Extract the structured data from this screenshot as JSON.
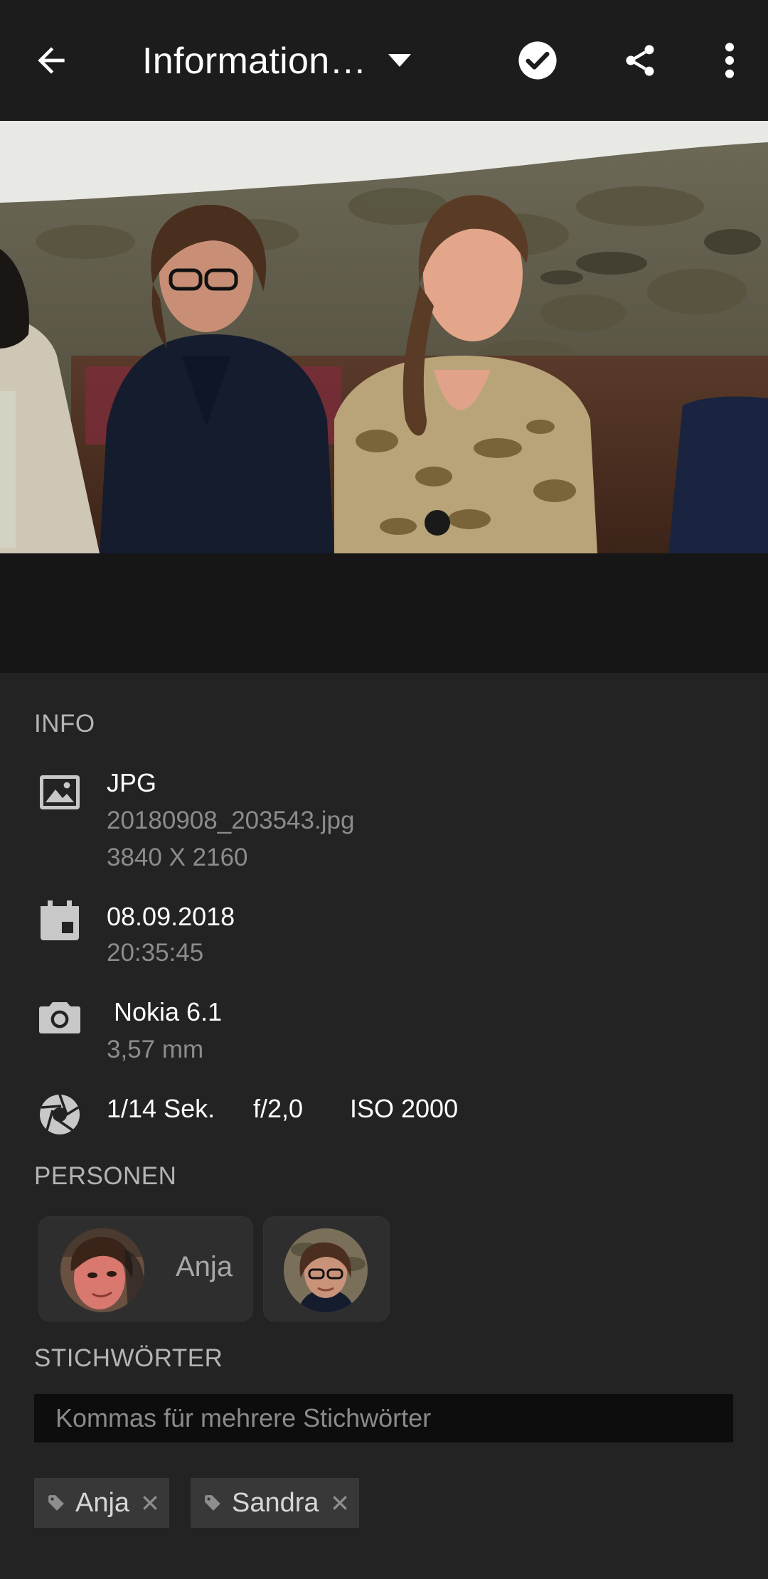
{
  "toolbar": {
    "title": "Information…",
    "back_icon": "arrow-left-icon",
    "check_icon": "check-circle-icon",
    "share_icon": "share-icon",
    "more_icon": "more-vertical-icon"
  },
  "info": {
    "section_title": "INFO",
    "file": {
      "icon": "image-icon",
      "format": "JPG",
      "filename": "20180908_203543.jpg",
      "dimensions": "3840 X 2160"
    },
    "date": {
      "icon": "calendar-icon",
      "date": "08.09.2018",
      "time": "20:35:45"
    },
    "camera": {
      "icon": "camera-icon",
      "model": " Nokia 6.1",
      "focal_length": "3,57 mm"
    },
    "exposure": {
      "icon": "aperture-icon",
      "shutter": "1/14 Sek.",
      "aperture": "f/2,0",
      "iso": "ISO 2000"
    }
  },
  "persons": {
    "section_title": "PERSONEN",
    "items": [
      {
        "name": "Anja"
      },
      {
        "name": ""
      }
    ]
  },
  "keywords": {
    "section_title": "STICHWÖRTER",
    "placeholder": "Kommas für mehrere Stichwörter",
    "tags": [
      {
        "label": "Anja"
      },
      {
        "label": "Sandra"
      }
    ]
  },
  "colors": {
    "background": "#1f1f1f",
    "toolbar": "#1c1c1c",
    "panel": "#232323",
    "primary_text": "#ffffff",
    "secondary_text": "#8c8c8c",
    "chip": "#383838"
  }
}
